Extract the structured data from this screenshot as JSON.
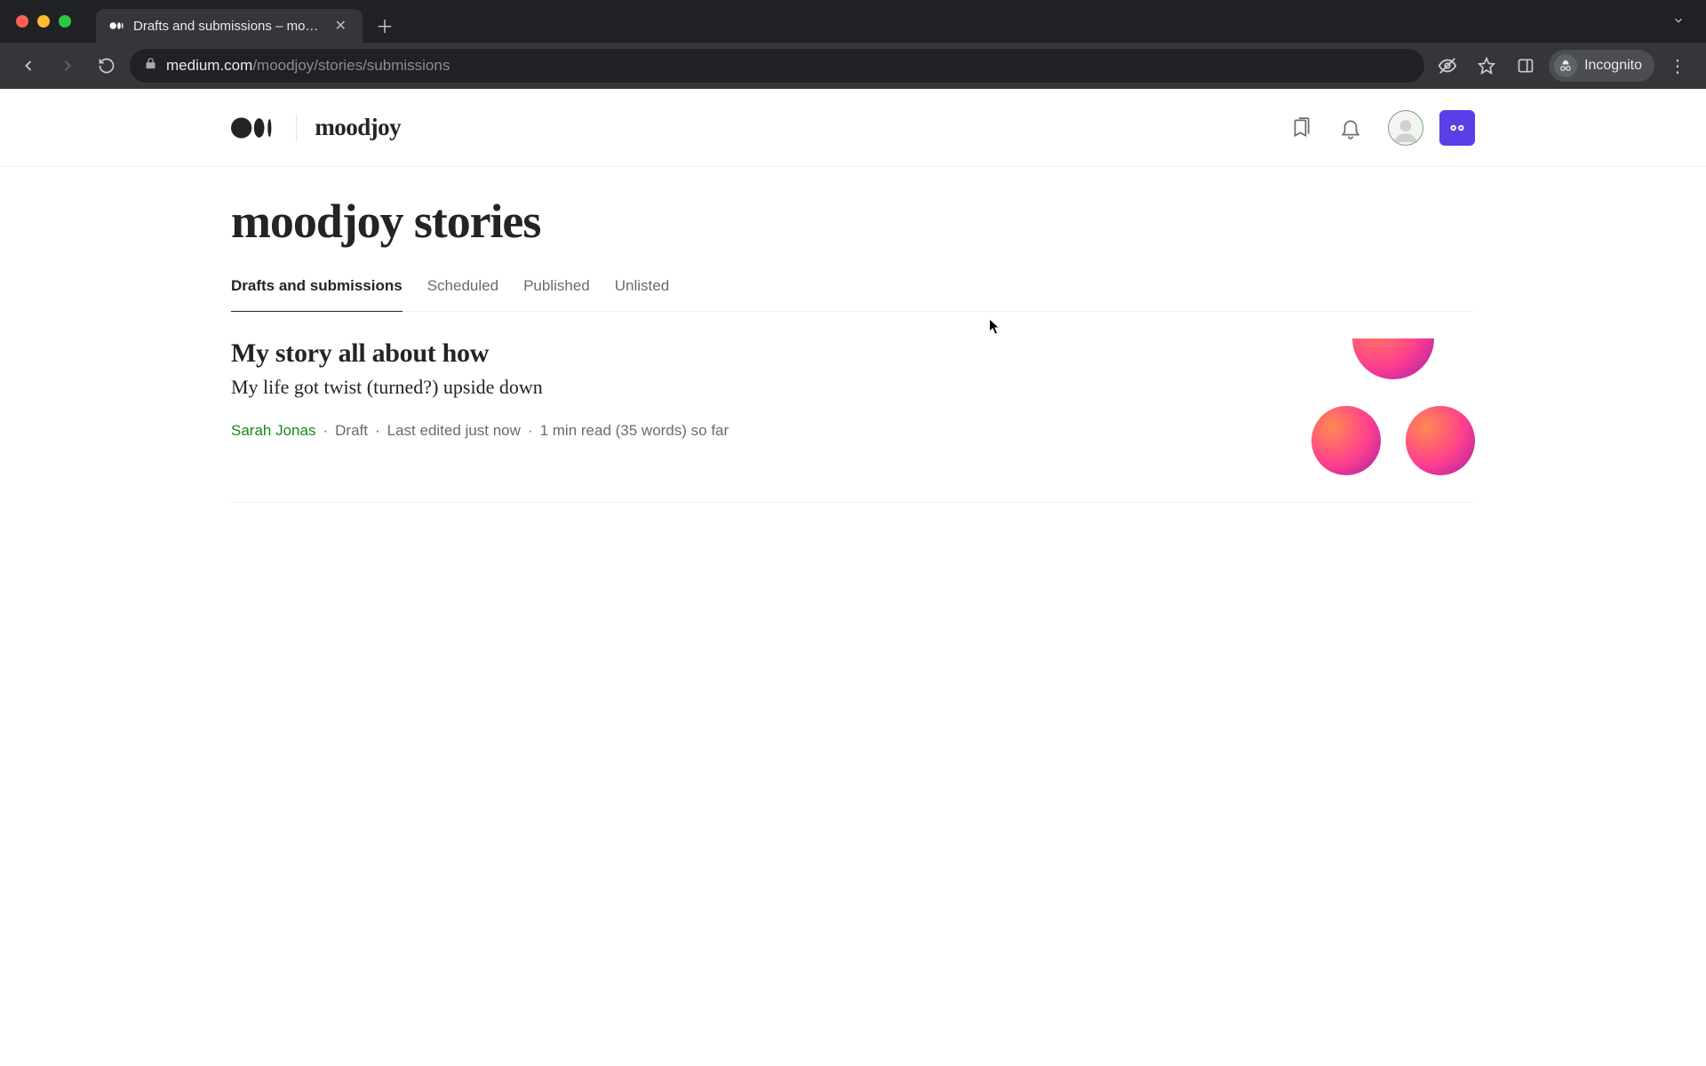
{
  "browser": {
    "tab_title": "Drafts and submissions – moo…",
    "url_host": "medium.com",
    "url_path": "/moodjoy/stories/submissions",
    "incognito_label": "Incognito"
  },
  "header": {
    "publication": "moodjoy"
  },
  "page": {
    "title": "moodjoy stories",
    "tabs": [
      {
        "label": "Drafts and submissions",
        "active": true
      },
      {
        "label": "Scheduled",
        "active": false
      },
      {
        "label": "Published",
        "active": false
      },
      {
        "label": "Unlisted",
        "active": false
      }
    ]
  },
  "story": {
    "title": "My story all about how",
    "subtitle": "My life got twist (turned?) upside down",
    "author": "Sarah Jonas",
    "status": "Draft",
    "edited": "Last edited just now",
    "length": "1 min read (35 words) so far"
  }
}
